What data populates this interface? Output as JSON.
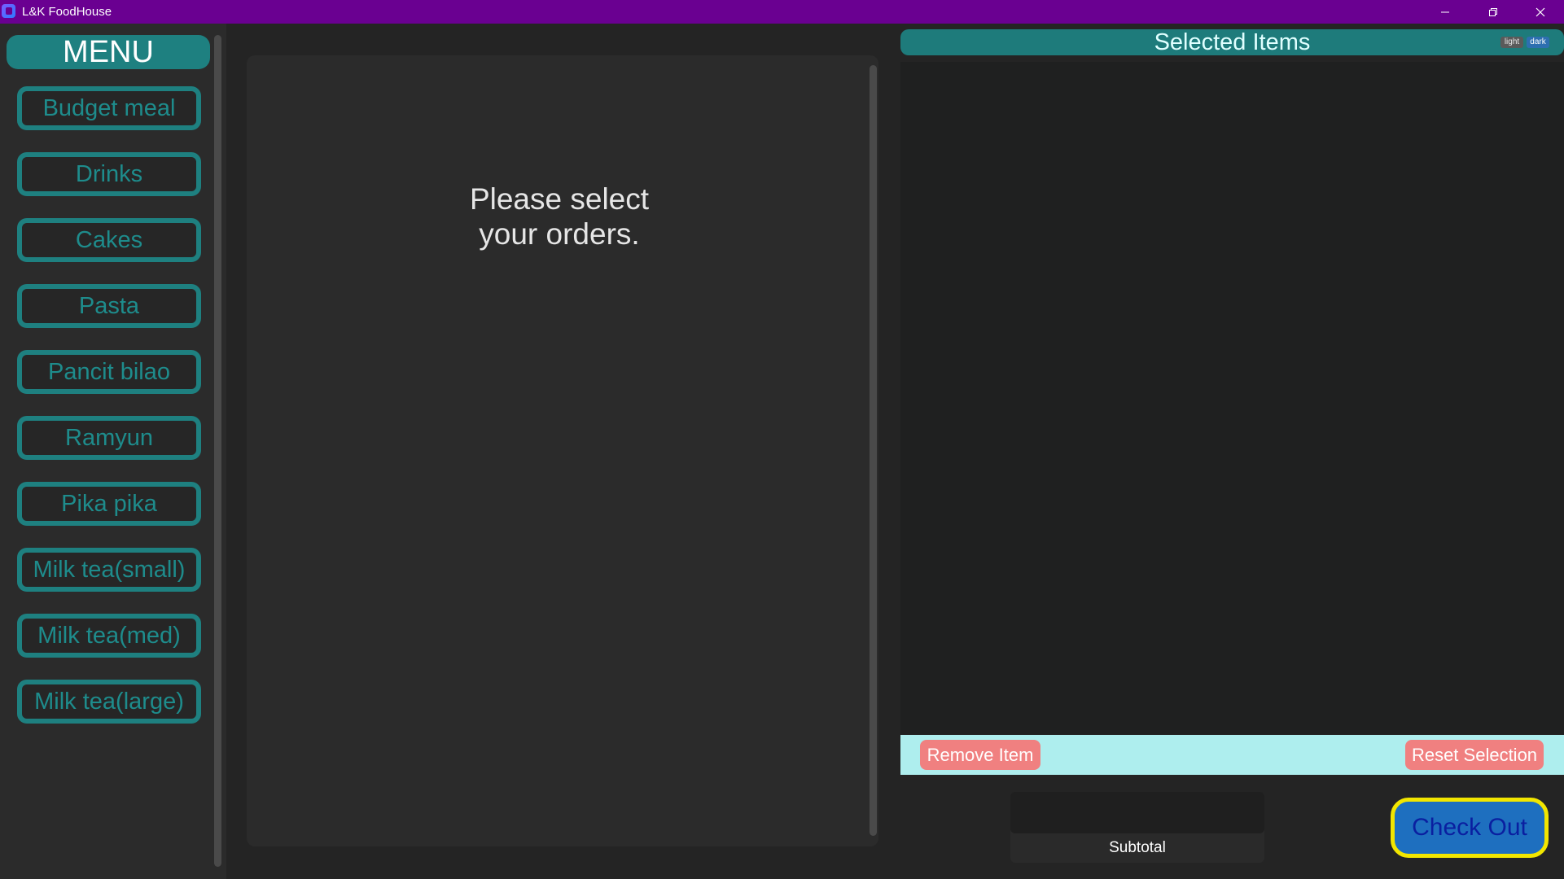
{
  "window": {
    "title": "L&K FoodHouse",
    "icon": "app-icon",
    "controls": [
      "minimize-icon",
      "restore-icon",
      "close-icon"
    ]
  },
  "sidebar": {
    "header": "MENU",
    "items": [
      {
        "label": "Budget meal"
      },
      {
        "label": "Drinks"
      },
      {
        "label": "Cakes"
      },
      {
        "label": "Pasta"
      },
      {
        "label": "Pancit bilao"
      },
      {
        "label": "Ramyun"
      },
      {
        "label": "Pika pika"
      },
      {
        "label": "Milk tea(small)"
      },
      {
        "label": "Milk tea(med)"
      },
      {
        "label": "Milk tea(large)"
      }
    ]
  },
  "main": {
    "prompt_line1": "Please select",
    "prompt_line2": "your orders."
  },
  "selected_panel": {
    "title": "Selected Items",
    "theme_light_label": "light",
    "theme_dark_label": "dark",
    "remove_label": "Remove Item",
    "reset_label": "Reset Selection",
    "subtotal_value": "",
    "subtotal_label": "Subtotal",
    "checkout_label": "Check Out"
  },
  "colors": {
    "titlebar": "#6a0091",
    "accent_teal": "#1e8080",
    "action_bar": "#aeeeee",
    "danger_button": "#f08080",
    "checkout_fill": "#1e6fbf",
    "checkout_border": "#f2e600"
  }
}
